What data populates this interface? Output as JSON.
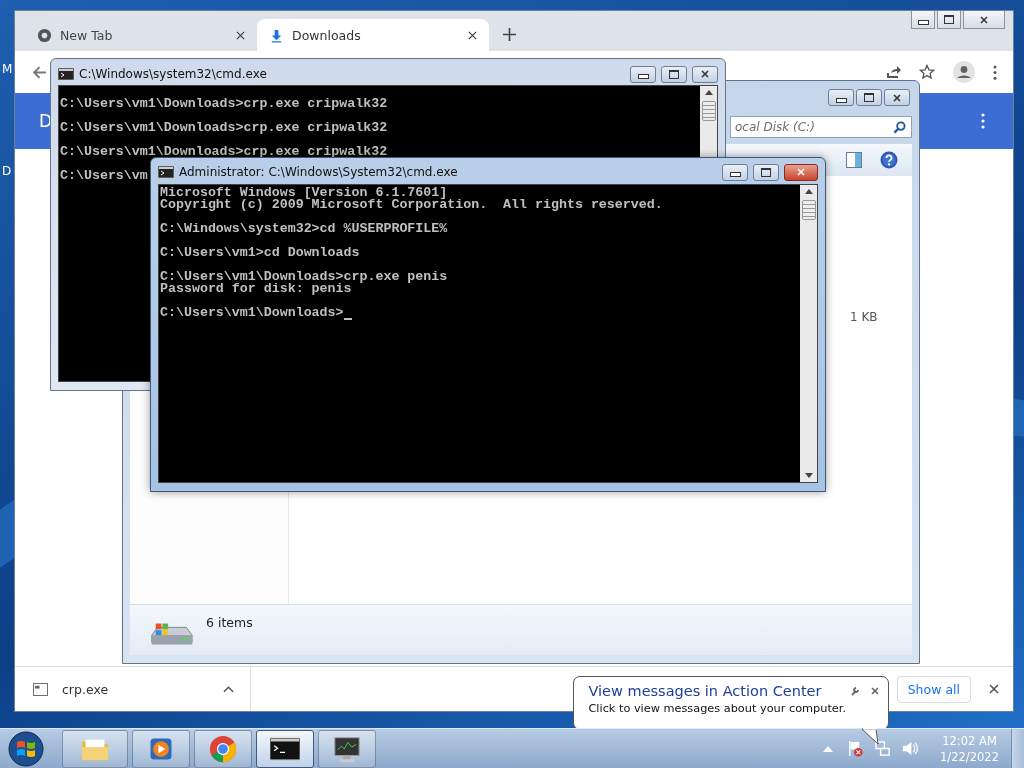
{
  "desktop_labels": [
    "M",
    "D"
  ],
  "browser": {
    "tabs": [
      {
        "label": "New Tab",
        "selected": false
      },
      {
        "label": "Downloads",
        "selected": true
      }
    ],
    "page_header": "D",
    "download_shelf": {
      "file": "crp.exe",
      "show_all": "Show all"
    }
  },
  "explorer": {
    "search": {
      "placeholder": "ocal Disk (C:)"
    },
    "file_size": "1 KB",
    "status": "6 items"
  },
  "console_back": {
    "title": "C:\\Windows\\system32\\cmd.exe",
    "active": false,
    "lines": [
      {
        "text": "C:\\Users\\vm1\\Downloads>crp.exe cripwalk32",
        "spaced": true
      },
      {
        "text": "C:\\Users\\vm1\\Downloads>crp.exe cripwalk32",
        "spaced": true
      },
      {
        "text": "C:\\Users\\vm1\\Downloads>crp.exe cripwalk32",
        "spaced": true
      },
      {
        "text": "C:\\Users\\vm",
        "spaced": true
      }
    ]
  },
  "console_front": {
    "title": "Administrator: C:\\Windows\\System32\\cmd.exe",
    "active": true,
    "cursor": true,
    "lines": [
      {
        "text": "Microsoft Windows [Version 6.1.7601]",
        "spaced": false
      },
      {
        "text": "Copyright (c) 2009 Microsoft Corporation.  All rights reserved.",
        "spaced": false
      },
      {
        "text": "C:\\Windows\\system32>cd %USERPROFILE%",
        "spaced": true
      },
      {
        "text": "C:\\Users\\vm1>cd Downloads",
        "spaced": true
      },
      {
        "text": "C:\\Users\\vm1\\Downloads>crp.exe penis",
        "spaced": true
      },
      {
        "text": "Password for disk: penis",
        "spaced": false
      },
      {
        "text": "C:\\Users\\vm1\\Downloads>",
        "spaced": true
      }
    ]
  },
  "notification": {
    "title": "View messages in Action Center",
    "message": "Click to view messages about your computer."
  },
  "taskbar": {
    "buttons": [
      {
        "kind": "folder",
        "selected": false
      },
      {
        "kind": "media",
        "selected": false
      },
      {
        "kind": "chrome",
        "selected": false
      },
      {
        "kind": "console",
        "selected": true
      },
      {
        "kind": "monitor",
        "selected": false
      }
    ],
    "time": "12:02 AM",
    "date": "1/22/2022"
  }
}
